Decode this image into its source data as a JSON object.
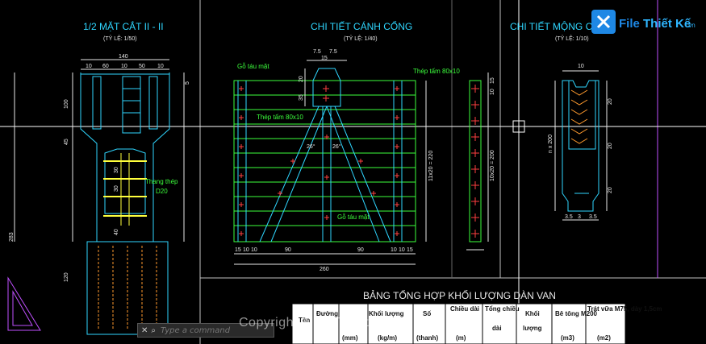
{
  "titles": {
    "section": "1/2 MẶT CẮT II - II",
    "section_scale": "(TỶ LỆ: 1/50)",
    "gate": "CHI TIẾT CÁNH CỔNG",
    "gate_scale": "(TỶ LỆ: 1/40)",
    "foundation": "CHI TIẾT MỘNG CỔNG",
    "foundation_scale": "(TỶ LỆ: 1/10)"
  },
  "section_dims": {
    "top_total": "140",
    "top_parts": [
      "10",
      "60",
      "10",
      "50",
      "10"
    ],
    "left_vertical": [
      "100",
      "45",
      "30",
      "30",
      "40",
      "283",
      "120"
    ],
    "right_top": "5",
    "inner": [
      "30",
      "30",
      "40"
    ],
    "ladder_label": "Thang thép",
    "ladder_size": "D20"
  },
  "gate_dims": {
    "top": [
      "7.5",
      "7.5",
      "15"
    ],
    "left_top": [
      "20",
      "35"
    ],
    "height_label": "11x20 = 220",
    "side_height": "10x20 = 200",
    "side_top": [
      "15",
      "10"
    ],
    "angle_left": "26°",
    "angle_right": "26°",
    "bottom_parts": [
      "15",
      "10",
      "10",
      "90",
      "90",
      "10",
      "10",
      "15"
    ],
    "bottom_total": "260",
    "note_top_left": "Gỗ táu mặt",
    "note_plate_left": "Thép tấm 80x10",
    "note_plate_right": "Thép tấm 80x10",
    "note_bottom": "Gỗ táu mặt"
  },
  "foundation_dims": {
    "top": "10",
    "right": [
      "20",
      "20",
      "20"
    ],
    "left": "n x 200",
    "bottom": [
      "3.5",
      "3",
      "3.5"
    ]
  },
  "table": {
    "title": "BẢNG TỔNG HỢP KHỐI LƯỢNG DÀN VAN",
    "headers": [
      "Tên",
      "Đường",
      "Khối lượng",
      "Số",
      "Chiều dài",
      "Tổng chiều",
      "Khối",
      "Bê tông M200",
      "Trát vữa M75, dày 1,5cm"
    ],
    "subheaders": [
      "",
      "(mm)",
      "(kg/m)",
      "(thanh)",
      "(m)",
      "dài",
      "lượng",
      "(m3)",
      "(m2)"
    ]
  },
  "command": {
    "placeholder": "Type a command",
    "close_glyph": "✕",
    "options_glyph": "⌕"
  },
  "brand": {
    "logo_text_1": "File",
    "logo_text_2": "Thiết Kế",
    "logo_text_3": ".vn",
    "watermark": "Copyright © FileThietKe.vn"
  },
  "colors": {
    "cyan": "#2fd6ff",
    "green": "#3cff3c",
    "yellow": "#ffff3c",
    "red": "#ff4040",
    "orange": "#ff9a2e",
    "magenta": "#c050ff",
    "white": "#e8e8e8"
  }
}
